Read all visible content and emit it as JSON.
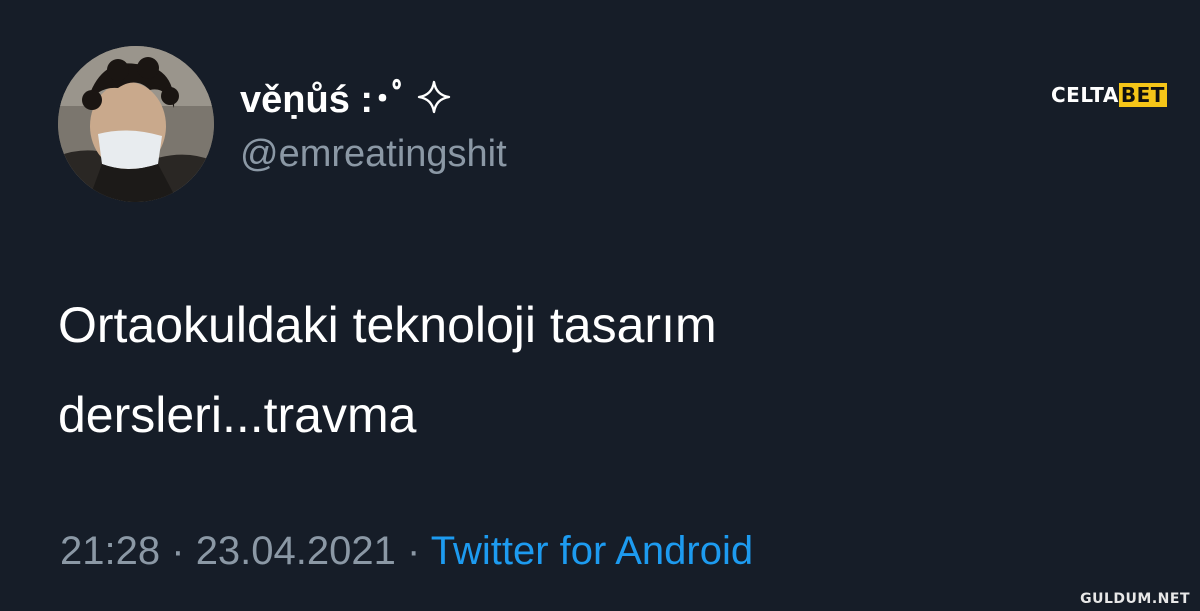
{
  "tweet": {
    "display_name": "věṇůś :･ﾟ",
    "sparkle_icon": "sparkle-icon",
    "handle": "@emreatingshit",
    "text_line1": "Ortaokuldaki teknoloji tasarım",
    "text_line2": "dersleri...travma",
    "time": "21:28",
    "separator": "·",
    "date": "23.04.2021",
    "source": "Twitter for Android"
  },
  "watermarks": {
    "top_part1": "CELTA",
    "top_part2": "BET",
    "bottom": "GULDUM.NET"
  },
  "colors": {
    "background": "#161d28",
    "secondary_text": "#8b98a5",
    "link": "#1d9bf0"
  }
}
